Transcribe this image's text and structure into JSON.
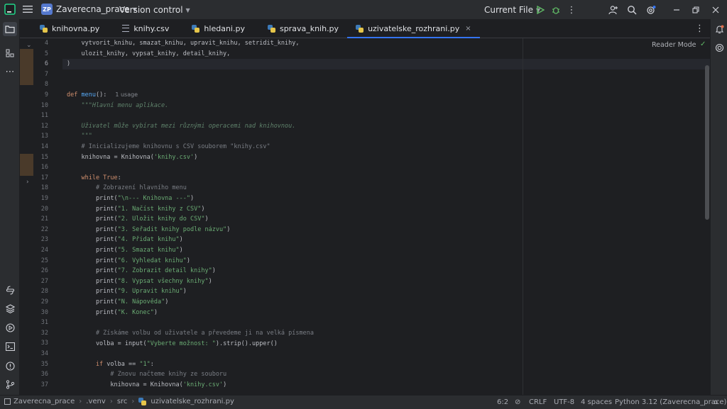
{
  "titlebar": {
    "project_badge": "ZP",
    "project_name": "Zaverecna_prace",
    "vcs": "Version control",
    "run_config": "Current File"
  },
  "tabs": [
    {
      "label": "knihovna.py",
      "type": "py"
    },
    {
      "label": "knihy.csv",
      "type": "csv"
    },
    {
      "label": "hledani.py",
      "type": "py"
    },
    {
      "label": "sprava_knih.py",
      "type": "py"
    },
    {
      "label": "uzivatelske_rozhrani.py",
      "type": "py",
      "active": true,
      "close": "×"
    }
  ],
  "editor": {
    "reader_mode": "Reader Mode",
    "usage_hint": "1 usage",
    "line_numbers": [
      "4",
      "5",
      "6",
      "7",
      "8",
      "9",
      "10",
      "11",
      "12",
      "13",
      "14",
      "15",
      "16",
      "17",
      "18",
      "19",
      "20",
      "21",
      "22",
      "23",
      "24",
      "25",
      "26",
      "27",
      "28",
      "29",
      "30",
      "31",
      "32",
      "33",
      "34",
      "35",
      "36",
      "37"
    ],
    "current_line": "6",
    "code": {
      "l4": "    vytvorit_knihu, smazat_knihu, upravit_knihu, setridit_knihy,",
      "l5": "    ulozit_knihy, vypsat_knihy, detail_knihy,",
      "l6": ")",
      "l9_kw": "def ",
      "l9_fn": "menu",
      "l9_rest": "():",
      "l10": "    \"\"\"Hlavní menu aplikace.",
      "l12": "    Uživatel může vybírat mezi různými operacemi nad knihovnou.",
      "l13": "    \"\"\"",
      "l14": "    # Inicializujeme knihovnu s CSV souborem \"knihy.csv\"",
      "l15_a": "    knihovna = Knihovna(",
      "l15_s": "'knihy.csv'",
      "l15_b": ")",
      "l17_kw": "    while True",
      "l17_b": ":",
      "l18": "        # Zobrazení hlavního menu",
      "prints": [
        "\"\\n--- Knihovna ---\"",
        "\"1. Načíst knihy z CSV\"",
        "\"2. Uložit knihy do CSV\"",
        "\"3. Seřadit knihy podle názvu\"",
        "\"4. Přidat knihu\"",
        "\"5. Smazat knihu\"",
        "\"6. Vyhledat knihu\"",
        "\"7. Zobrazit detail knihy\"",
        "\"8. Vypsat všechny knihy\"",
        "\"9. Upravit knihu\"",
        "\"N. Nápověda\"",
        "\"K. Konec\""
      ],
      "print_kw": "        print(",
      "print_end": ")",
      "l32": "        # Získáme volbu od uživatele a převedeme ji na velká písmena",
      "l33_a": "        volba = input(",
      "l33_s": "\"Vyberte možnost: \"",
      "l33_b": ").strip().upper()",
      "l35_kw": "        if ",
      "l35_a": "volba == ",
      "l35_s": "\"1\"",
      "l35_b": ":",
      "l36": "            # Znovu načteme knihy ze souboru",
      "l37_a": "            knihovna = Knihovna(",
      "l37_s": "'knihy.csv'",
      "l37_b": ")"
    }
  },
  "status": {
    "crumbs": [
      "Zaverecna_prace",
      ".venv",
      "src",
      "uzivatelske_rozhrani.py"
    ],
    "position": "6:2",
    "line_sep": "CRLF",
    "encoding": "UTF-8",
    "indent": "4 spaces",
    "interpreter": "Python 3.12 (Zaverecna_prace)"
  }
}
